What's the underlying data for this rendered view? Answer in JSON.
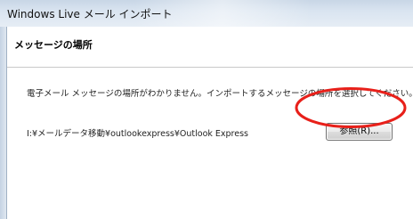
{
  "window": {
    "title": "Windows Live メール インポート"
  },
  "header": {
    "title": "メッセージの場所"
  },
  "body": {
    "description": "電子メール メッセージの場所がわかりません。インポートするメッセージの場所を選択してください。",
    "path": "I:¥メールデータ移動¥outlookexpress¥Outlook Express"
  },
  "buttons": {
    "browse_label": "参照(R)..."
  },
  "colors": {
    "annotation_circle": "#e8201a"
  }
}
